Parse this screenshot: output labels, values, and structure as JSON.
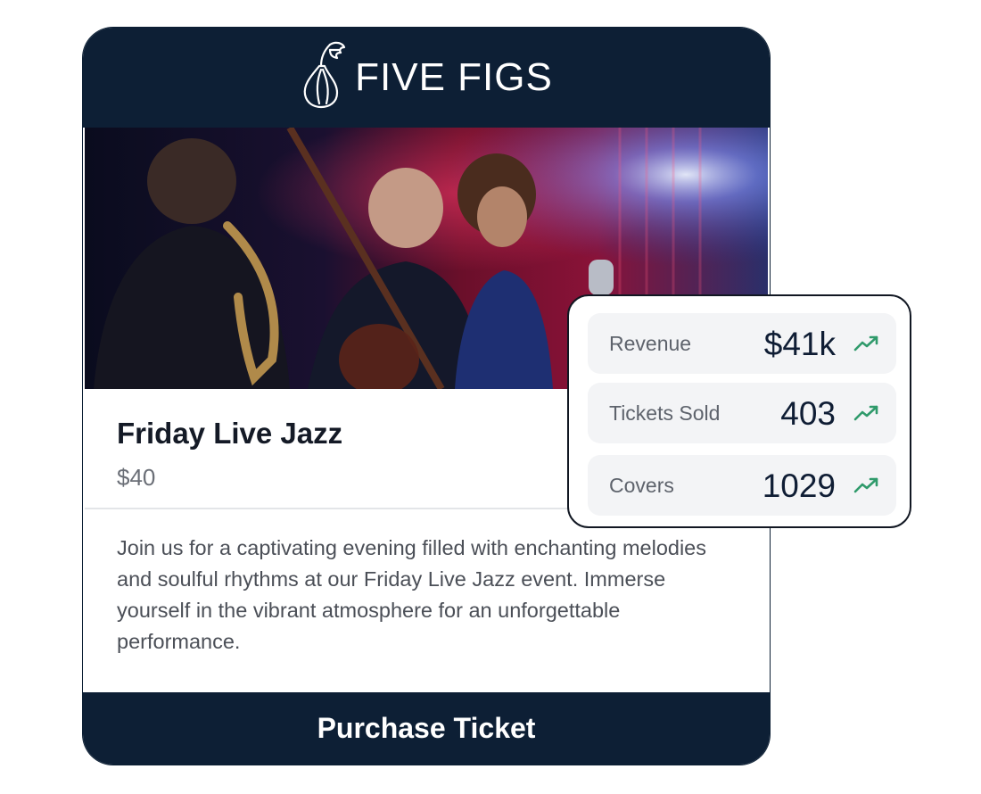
{
  "header": {
    "brand_name": "FIVE FIGS"
  },
  "event": {
    "title": "Friday Live Jazz",
    "price": "$40",
    "description": "Join us for a captivating evening filled with enchanting melodies and soulful rhythms at our Friday Live Jazz event. Immerse yourself in the vibrant atmosphere for an unforgettable performance.",
    "cta_label": "Purchase Ticket"
  },
  "stats": [
    {
      "label": "Revenue",
      "value": "$41k",
      "trend_icon": "trend-up-icon"
    },
    {
      "label": "Tickets Sold",
      "value": "403",
      "trend_icon": "trend-up-icon"
    },
    {
      "label": "Covers",
      "value": "1029",
      "trend_icon": "trend-up-icon"
    }
  ],
  "colors": {
    "navy": "#0d1f35",
    "trend_green": "#2f9a6b",
    "stat_bg": "#f3f4f6"
  }
}
